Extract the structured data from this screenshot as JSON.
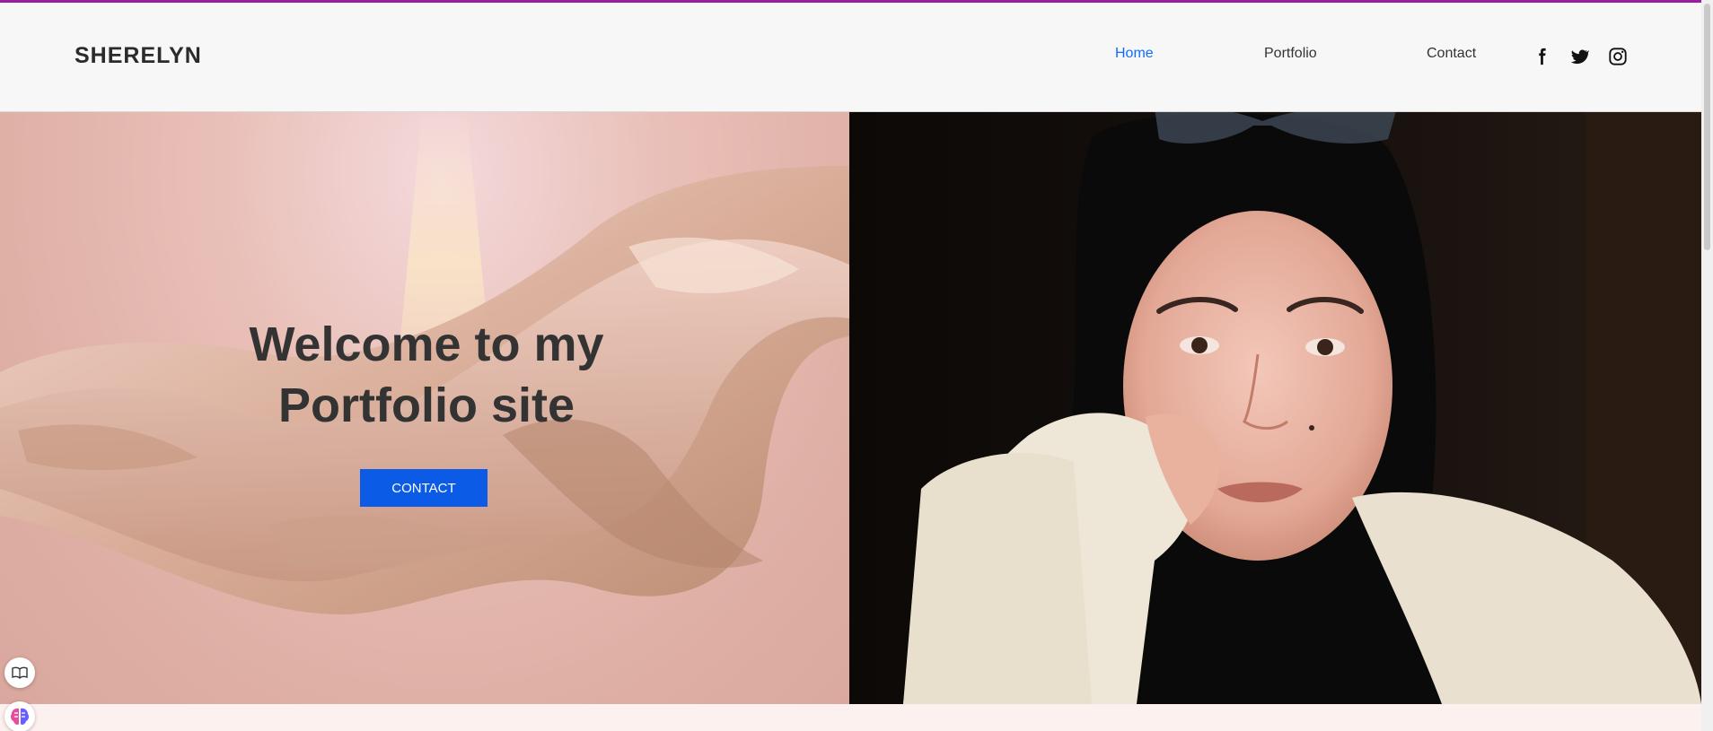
{
  "header": {
    "brand": "SHERELYN",
    "nav": [
      {
        "label": "Home",
        "active": true
      },
      {
        "label": "Portfolio",
        "active": false
      },
      {
        "label": "Contact",
        "active": false
      }
    ],
    "social_icons": [
      "facebook-icon",
      "twitter-icon",
      "instagram-icon"
    ]
  },
  "hero": {
    "headline_line1": "Welcome to my",
    "headline_line2": "Portfolio site",
    "cta_label": "CONTACT"
  },
  "floating_widgets": [
    "reader-icon",
    "brain-icon"
  ],
  "colors": {
    "accent_bar": "#9b1fa3",
    "nav_active": "#116dff",
    "cta_background": "#0c5be6",
    "hero_left_background": "#e3b7ae",
    "text_dark": "#333333"
  }
}
